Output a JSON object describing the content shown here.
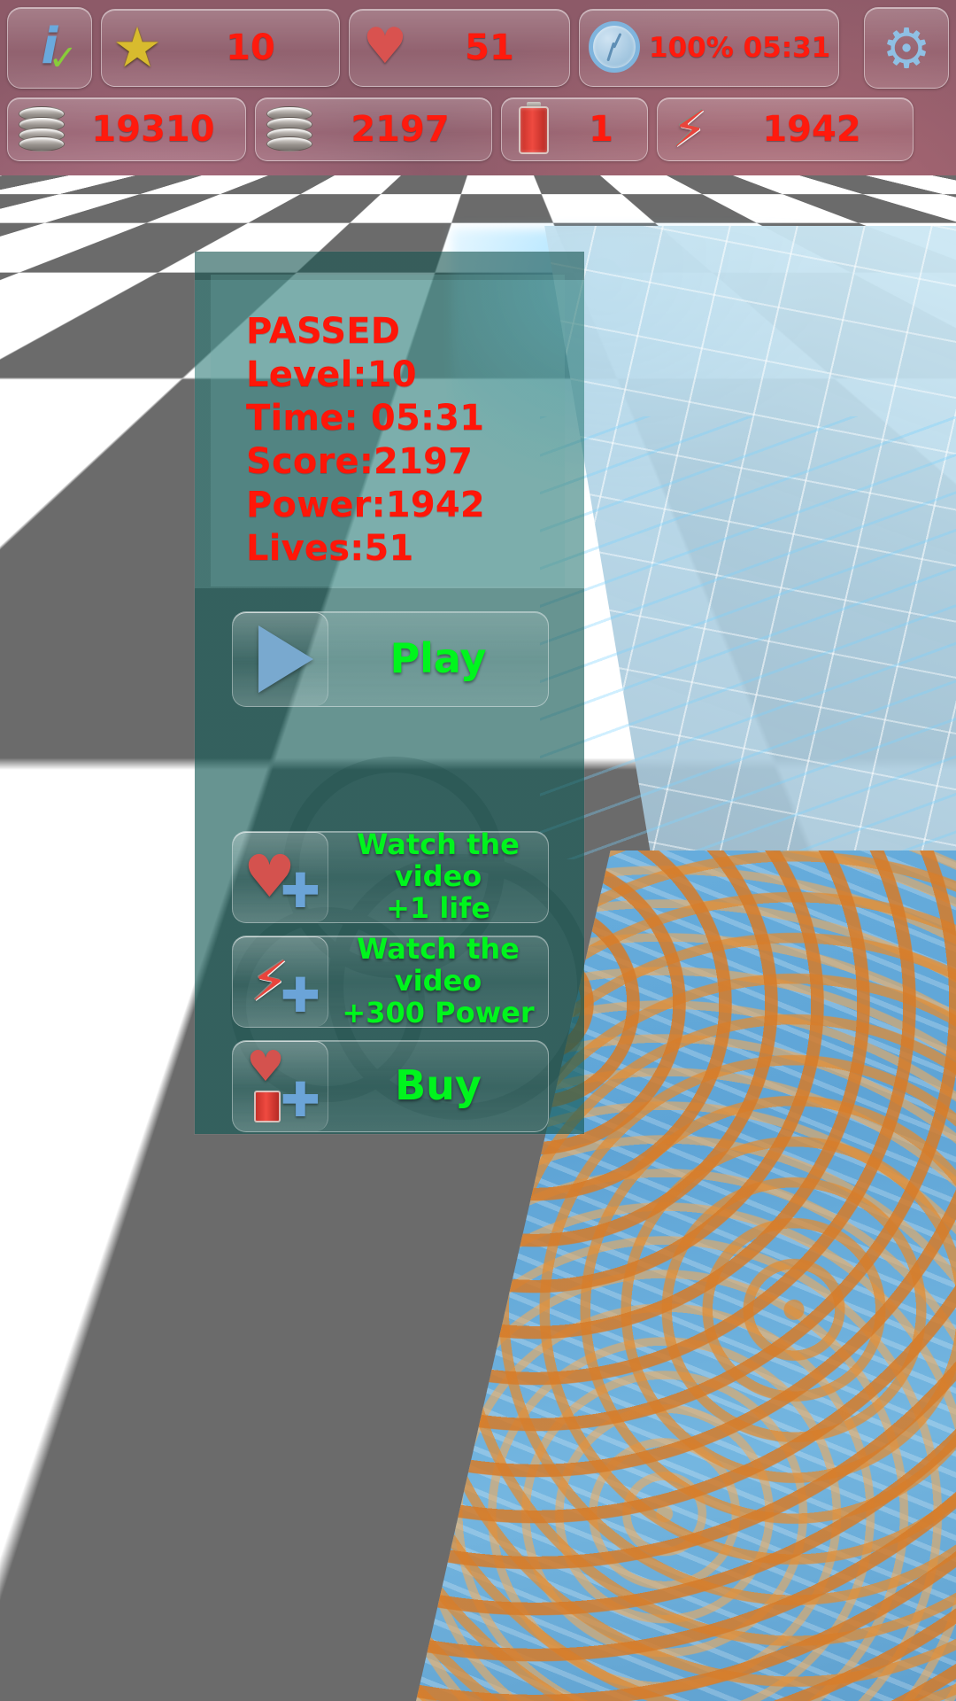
{
  "hud": {
    "row1": [
      {
        "name": "info-button",
        "icon": "info-check-icon",
        "value": ""
      },
      {
        "name": "stars-counter",
        "icon": "star-icon",
        "value": "10"
      },
      {
        "name": "lives-counter",
        "icon": "heart-icon",
        "value": "51"
      },
      {
        "name": "timer-counter",
        "icon": "clock-icon",
        "value": "100% 05:31"
      },
      {
        "name": "settings-button",
        "icon": "gear-icon",
        "value": ""
      }
    ],
    "row2": [
      {
        "name": "coins-counter",
        "icon": "coin-stack-icon",
        "value": "19310"
      },
      {
        "name": "score-counter",
        "icon": "coin-stack-icon",
        "value": "2197"
      },
      {
        "name": "battery-counter",
        "icon": "battery-icon",
        "value": "1"
      },
      {
        "name": "power-counter",
        "icon": "bolt-icon",
        "value": "1942"
      }
    ]
  },
  "dialog": {
    "stats": [
      "PASSED",
      "Level:10",
      "Time: 05:31",
      "Score:2197",
      "Power:1942",
      "Lives:51"
    ],
    "buttons": {
      "play": {
        "label": "Play",
        "icon": "play-triangle-icon"
      },
      "watch_life": {
        "label": "Watch the video\n+1 life",
        "line1": "Watch the video",
        "line2": "+1 life",
        "icon": "heart-plus-icon"
      },
      "watch_power": {
        "label": "Watch the video\n+300 Power",
        "line1": "Watch the video",
        "line2": "+300 Power",
        "icon": "bolt-plus-icon"
      },
      "buy": {
        "label": "Buy",
        "icon": "heart-battery-plus-icon"
      }
    }
  },
  "colors": {
    "hud_value_red": "#ff1a0d",
    "stat_red": "#ff1608",
    "button_green": "#00f51d",
    "panel_teal": "#2e7c78"
  }
}
